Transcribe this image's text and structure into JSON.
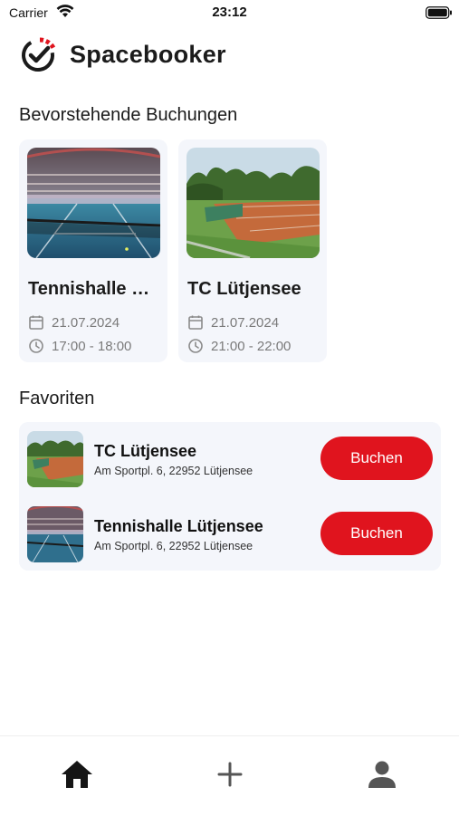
{
  "status_bar": {
    "carrier": "Carrier",
    "time": "23:12"
  },
  "app": {
    "title": "Spacebooker"
  },
  "upcoming": {
    "title": "Bevorstehende Buchungen",
    "cards": [
      {
        "name": "Tennishalle Lütjensee",
        "date": "21.07.2024",
        "time": "17:00 - 18:00",
        "image": "indoor-tennis-hall-photo"
      },
      {
        "name": "TC Lütjensee",
        "date": "21.07.2024",
        "time": "21:00 - 22:00",
        "image": "outdoor-clay-court-photo"
      }
    ]
  },
  "favorites": {
    "title": "Favoriten",
    "items": [
      {
        "name": "TC Lütjensee",
        "address": "Am Sportpl. 6, 22952 Lütjensee",
        "button": "Buchen",
        "image": "outdoor-clay-court-photo"
      },
      {
        "name": "Tennishalle Lütjensee",
        "address": "Am Sportpl. 6, 22952 Lütjensee",
        "button": "Buchen",
        "image": "indoor-tennis-hall-photo"
      }
    ]
  },
  "tabbar": {
    "items": [
      {
        "icon": "home-icon",
        "active": true
      },
      {
        "icon": "plus-icon",
        "active": false
      },
      {
        "icon": "person-icon",
        "active": false
      }
    ]
  },
  "colors": {
    "accent": "#e0141e",
    "card_bg": "#f4f6fb",
    "text": "#1b1b1b",
    "muted": "#7a7a7a"
  }
}
